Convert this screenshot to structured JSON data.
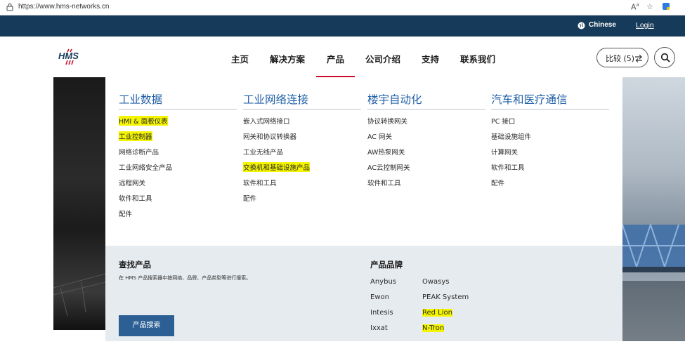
{
  "browser": {
    "url": "https://www.hms-networks.cn"
  },
  "topbar": {
    "language": "Chinese",
    "login": "Login"
  },
  "header": {
    "logo_text": "HMS",
    "nav": [
      "主页",
      "解决方案",
      "产品",
      "公司介绍",
      "支持",
      "联系我们"
    ],
    "active_nav": "产品",
    "compare_label": "比较 (5)"
  },
  "mega_menu": {
    "columns": [
      {
        "title": "工业数据",
        "items": [
          "HMI & 面板仪表",
          "工业控制器",
          "网络诊断产品",
          "工业网络安全产品",
          "远程网关",
          "软件和工具",
          "配件"
        ]
      },
      {
        "title": "工业网络连接",
        "items": [
          "嵌入式网络接口",
          "网关和协议转换器",
          "工业无线产品",
          "交换机和基础设施产品",
          "软件和工具",
          "配件"
        ]
      },
      {
        "title": "楼宇自动化",
        "items": [
          "协议转换网关",
          "AC 网关",
          "AW热泵网关",
          "AC云控制网关",
          "软件和工具"
        ]
      },
      {
        "title": "汽车和医疗通信",
        "items": [
          "PC 接口",
          "基础设施组件",
          "计算网关",
          "软件和工具",
          "配件"
        ]
      }
    ]
  },
  "find_products": {
    "title": "查找产品",
    "description": "在 HMS 产品搜索器中按网络、品牌、产品类型等进行搜索。",
    "button": "产品搜索"
  },
  "brands": {
    "title": "产品品牌",
    "left": [
      "Anybus",
      "Ewon",
      "Intesis",
      "Ixxat"
    ],
    "right": [
      "Owasys",
      "PEAK System",
      "Red Lion",
      "N-Tron"
    ]
  },
  "colors": {
    "topbar": "#163a59",
    "accent_blue": "#1f5fa8",
    "active_underline": "#c8102e",
    "highlight": "#f5f500",
    "cta": "#2c5f94"
  }
}
